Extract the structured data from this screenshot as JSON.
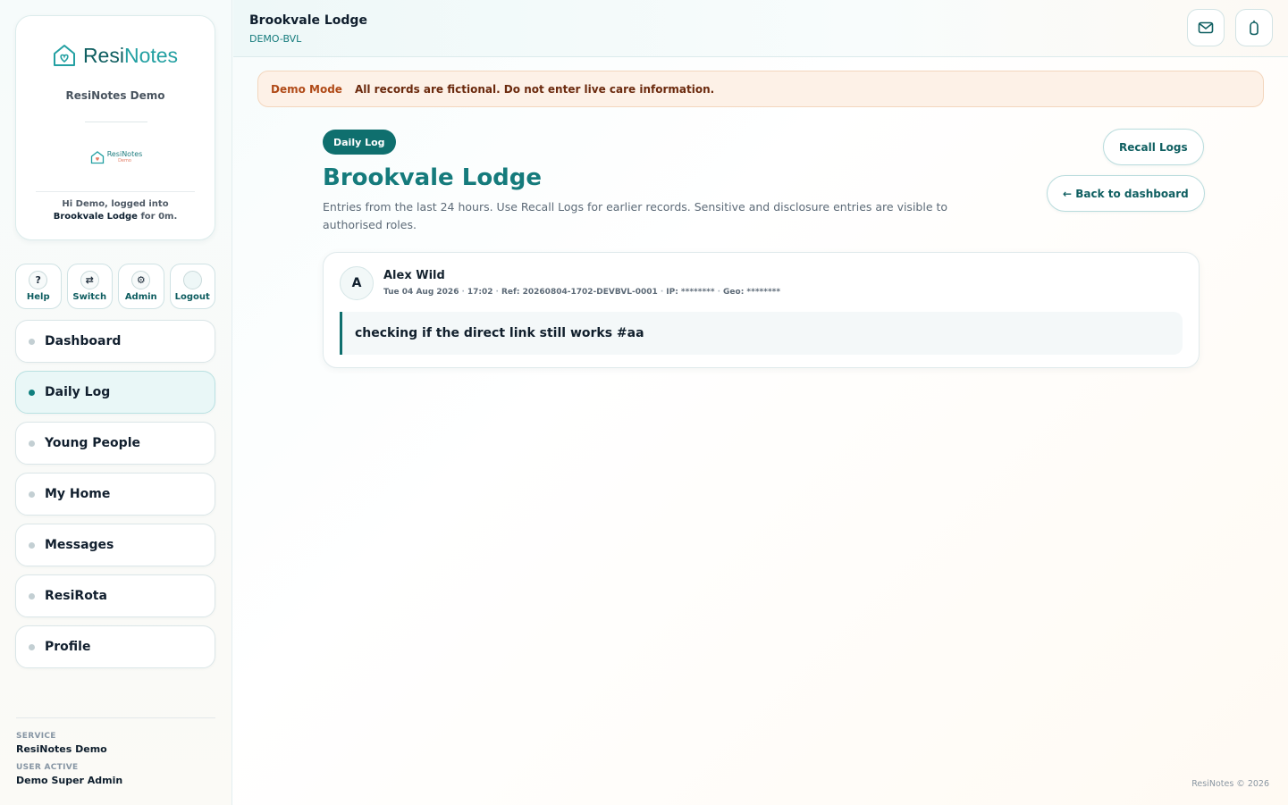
{
  "brand": {
    "name_part1": "Resi",
    "name_part2": "Notes",
    "subtitle": "ResiNotes Demo",
    "org_badge_line1": "ResiNotes",
    "org_badge_line2": "Demo",
    "login_prefix": "Hi Demo, logged into ",
    "login_home": "Brookvale Lodge",
    "login_suffix": " for 0m."
  },
  "quick_actions": [
    {
      "label": "Help",
      "glyph": "?"
    },
    {
      "label": "Switch",
      "glyph": "⇄"
    },
    {
      "label": "Admin",
      "glyph": "⚙"
    },
    {
      "label": "Logout",
      "glyph": ""
    }
  ],
  "nav": [
    {
      "label": "Dashboard",
      "active": false
    },
    {
      "label": "Daily Log",
      "active": true
    },
    {
      "label": "Young People",
      "active": false
    },
    {
      "label": "My Home",
      "active": false
    },
    {
      "label": "Messages",
      "active": false
    },
    {
      "label": "ResiRota",
      "active": false
    },
    {
      "label": "Profile",
      "active": false
    }
  ],
  "footer": {
    "service_label": "SERVICE",
    "service_value": "ResiNotes Demo",
    "user_label": "USER ACTIVE",
    "user_value": "Demo Super Admin"
  },
  "topbar": {
    "title": "Brookvale Lodge",
    "code": "DEMO-BVL",
    "icons": [
      "mail-icon",
      "bell-icon"
    ]
  },
  "banner": {
    "label": "Demo Mode",
    "text": "All records are fictional. Do not enter live care information."
  },
  "page": {
    "pill": "Daily Log",
    "title": "Brookvale Lodge",
    "description": "Entries from the last 24 hours. Use Recall Logs for earlier records. Sensitive and disclosure entries are visible to authorised roles.",
    "recall_button": "Recall Logs",
    "back_button": "← Back to dashboard"
  },
  "entries": [
    {
      "avatar_letter": "A",
      "author": "Alex Wild",
      "date": "Tue 04 Aug 2026",
      "time": "17:02",
      "ref": "Ref: 20260804-1702-DEVBVL-0001",
      "ip": "IP: ********",
      "geo": "Geo: ********",
      "text": "checking if the direct link still works #aa"
    }
  ],
  "copyright": "ResiNotes © 2026",
  "colors": {
    "brand_teal": "#0f6f6e",
    "title_teal": "#157b7c",
    "banner_bg": "#fdf1e7",
    "banner_label": "#b04a17"
  }
}
